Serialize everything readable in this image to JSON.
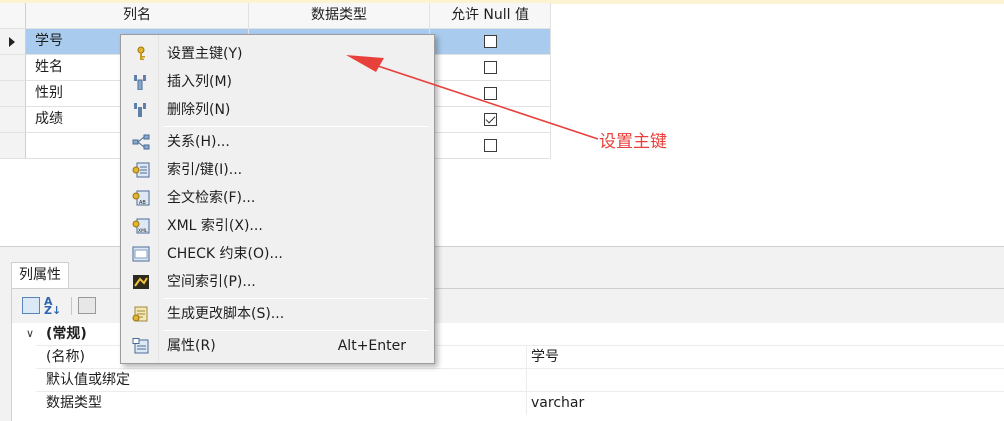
{
  "grid": {
    "headers": [
      "列名",
      "数据类型",
      "允许 Null 值"
    ],
    "rows": [
      {
        "name": "学号",
        "allow_null": false,
        "selected": true
      },
      {
        "name": "姓名",
        "allow_null": false,
        "selected": false
      },
      {
        "name": "性别",
        "allow_null": false,
        "selected": false
      },
      {
        "name": "成绩",
        "allow_null": true,
        "selected": false
      },
      {
        "name": "",
        "allow_null": false,
        "selected": false
      }
    ]
  },
  "context_menu": {
    "items": [
      {
        "label": "设置主键(Y)",
        "icon": "primary-key-icon"
      },
      {
        "label": "插入列(M)",
        "icon": "insert-column-icon"
      },
      {
        "label": "删除列(N)",
        "icon": "delete-column-icon"
      },
      {
        "label": "关系(H)...",
        "icon": "relationships-icon"
      },
      {
        "label": "索引/键(I)...",
        "icon": "index-keys-icon"
      },
      {
        "label": "全文检索(F)...",
        "icon": "fulltext-index-icon"
      },
      {
        "label": "XML 索引(X)...",
        "icon": "xml-index-icon"
      },
      {
        "label": "CHECK 约束(O)...",
        "icon": "check-constraint-icon"
      },
      {
        "label": "空间索引(P)...",
        "icon": "spatial-index-icon"
      },
      {
        "label": "生成更改脚本(S)...",
        "icon": "generate-script-icon"
      },
      {
        "label": "属性(R)",
        "icon": "properties-icon",
        "shortcut": "Alt+Enter"
      }
    ]
  },
  "annotation": {
    "text": "设置主键",
    "color": "#e8413c"
  },
  "properties": {
    "tab_label": "列属性",
    "group": "(常规)",
    "rows": [
      {
        "name": "(名称)",
        "value": "学号"
      },
      {
        "name": "默认值或绑定",
        "value": ""
      },
      {
        "name": "数据类型",
        "value": "varchar"
      }
    ]
  },
  "colors": {
    "selection": "#a9cbee",
    "menu_bg": "#f0f0f0",
    "accent_red": "#e8413c"
  }
}
